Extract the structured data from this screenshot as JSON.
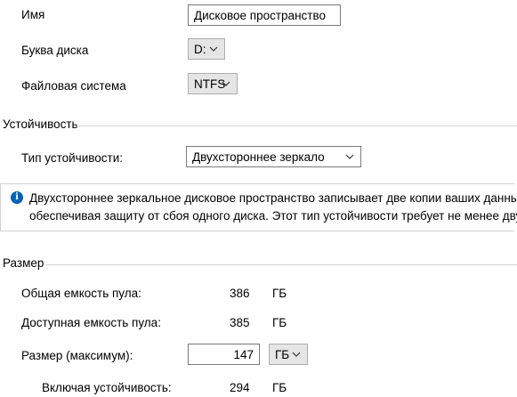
{
  "fields": {
    "name_label": "Имя",
    "name_value": "Дисковое пространство",
    "drive_letter_label": "Буква диска",
    "drive_letter_value": "D:",
    "filesystem_label": "Файловая система",
    "filesystem_value": "NTFS"
  },
  "resiliency": {
    "section_title": "Устойчивость",
    "type_label": "Тип устойчивости:",
    "type_value": "Двухстороннее зеркало",
    "info_line1": "Двухстороннее зеркальное дисковое пространство записывает две копии ваших данных",
    "info_line2": "обеспечивая защиту от сбоя одного диска. Этот тип устойчивости требует не менее двух"
  },
  "size": {
    "section_title": "Размер",
    "total_pool_label": "Общая емкость пула:",
    "total_pool_value": "386",
    "total_pool_unit": "ГБ",
    "available_pool_label": "Доступная емкость пула:",
    "available_pool_value": "385",
    "available_pool_unit": "ГБ",
    "size_max_label": "Размер (максимум):",
    "size_max_value": "147",
    "size_unit_value": "ГБ",
    "including_label": "Включая устойчивость:",
    "including_value": "294",
    "including_unit": "ГБ"
  },
  "icons": {
    "info": "info-icon",
    "dropdown": "chevron-down-icon"
  }
}
